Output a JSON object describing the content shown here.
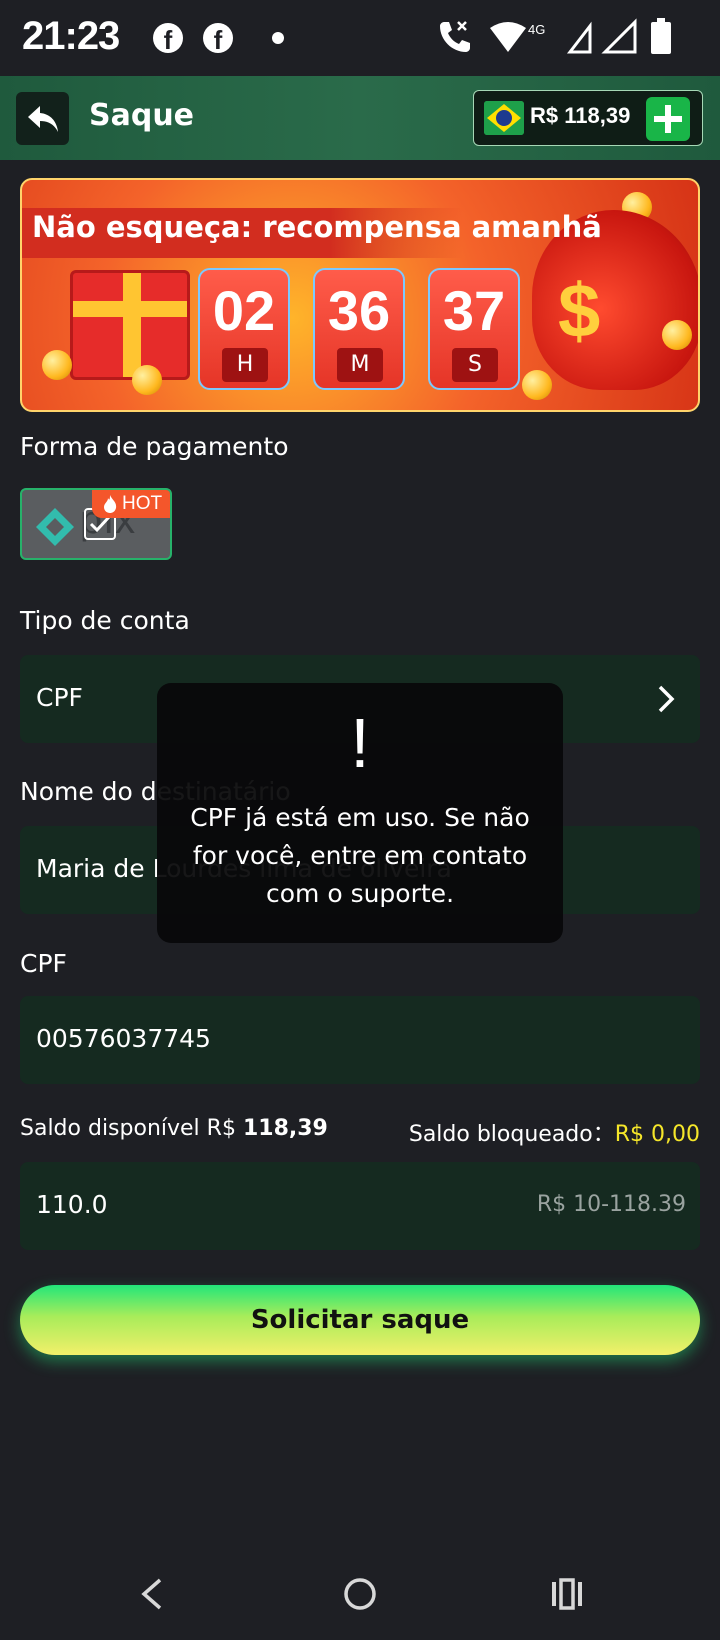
{
  "status_bar": {
    "time": "21:23",
    "icons": [
      "facebook-icon",
      "facebook-icon",
      "notification-dot-icon",
      "wifi-call-icon",
      "wifi-icon",
      "signal-icon",
      "signal-icon",
      "battery-icon"
    ],
    "network_label": "4G"
  },
  "header": {
    "title": "Saque",
    "balance": "R$ 118,39",
    "flag": "brazil-flag-icon"
  },
  "banner": {
    "title": "Não esqueça: recompensa amanhã",
    "timer": [
      {
        "value": "02",
        "unit": "H"
      },
      {
        "value": "36",
        "unit": "M"
      },
      {
        "value": "37",
        "unit": "S"
      }
    ],
    "dollar_sign": "$"
  },
  "payment": {
    "label": "Forma de pagamento",
    "method": "pix",
    "badge": "HOT"
  },
  "account_type": {
    "label": "Tipo de conta",
    "value": "CPF"
  },
  "recipient": {
    "label": "Nome do destinatário",
    "value": "Maria de Lourdes lima de oliveira"
  },
  "cpf": {
    "label": "CPF",
    "value": "00576037745"
  },
  "balance_info": {
    "available_label": "Saldo disponível R$",
    "available_value": "118,39",
    "blocked_label": "Saldo bloqueado：",
    "blocked_value": "R$ 0,00"
  },
  "amount": {
    "value": "110.0",
    "range": "R$ 10-118.39"
  },
  "submit": {
    "label": "Solicitar saque"
  },
  "toast": {
    "icon": "!",
    "message": "CPF já está em uso. Se não for você, entre em contato com o suporte."
  },
  "colors": {
    "background": "#1e1f24",
    "header": "#2a6b4a",
    "field": "#152a20",
    "accent_green": "#19b548",
    "blocked_yellow": "#f5e62a"
  }
}
